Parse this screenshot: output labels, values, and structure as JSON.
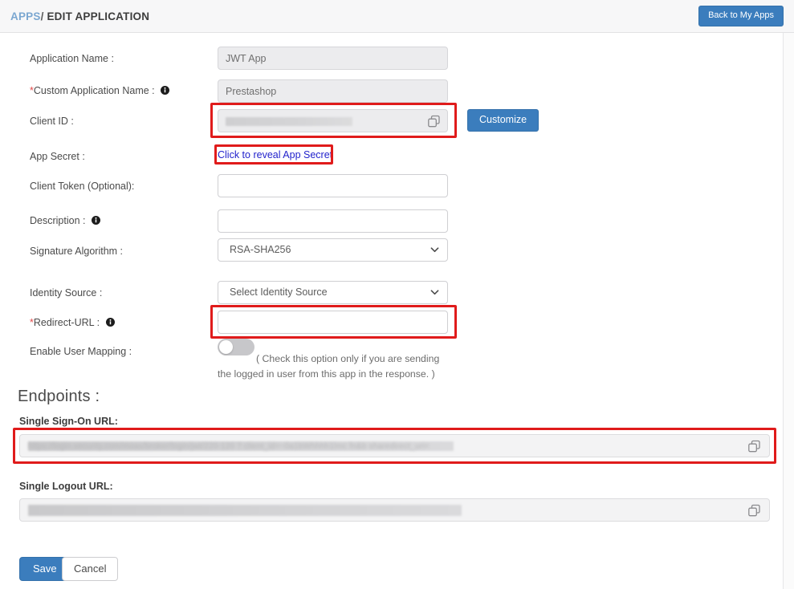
{
  "header": {
    "breadcrumb_root": "APPS",
    "breadcrumb_separator": "/",
    "breadcrumb_current": "EDIT APPLICATION",
    "back_button": "Back to My Apps",
    "accent_color": "#3b7dbd",
    "breadcrumb_link_color": "#7ba7d1"
  },
  "form": {
    "application_name": {
      "label": "Application Name :",
      "value": "JWT App",
      "readonly": true
    },
    "custom_application_name": {
      "label": "Custom Application Name :",
      "required_marker": "*",
      "value": "Prestashop",
      "readonly": true,
      "info_icon": "info-icon"
    },
    "client_id": {
      "label": "Client ID :",
      "value": "",
      "masked": true,
      "copy_icon": "copy-icon",
      "highlighted": true
    },
    "customize_button": "Customize",
    "app_secret": {
      "label": "App Secret :",
      "reveal_link": "Click to reveal App Secret",
      "link_color": "#2222cc",
      "highlighted": true
    },
    "client_token": {
      "label": "Client Token (Optional):",
      "value": "",
      "placeholder": ""
    },
    "description": {
      "label": "Description :",
      "value": "",
      "placeholder": "",
      "info_icon": "info-icon"
    },
    "signature_algorithm": {
      "label": "Signature Algorithm :",
      "selected": "RSA-SHA256",
      "chevron_icon": "chevron-down-icon"
    },
    "identity_source": {
      "label": "Identity Source :",
      "selected": "Select Identity Source",
      "chevron_icon": "chevron-down-icon"
    },
    "redirect_url": {
      "label": "Redirect-URL :",
      "required_marker": "*",
      "value": "",
      "placeholder": "",
      "info_icon": "info-icon",
      "highlighted": true
    },
    "enable_user_mapping": {
      "label": "Enable User Mapping :",
      "toggle_state": "off",
      "hint": "( Check this option only if you are sending the logged in user from this app in the response. )"
    }
  },
  "endpoints": {
    "title": "Endpoints :",
    "single_sign_on": {
      "label": "Single Sign-On URL:",
      "value": "",
      "masked": true,
      "copy_icon": "copy-icon",
      "highlighted": true
    },
    "single_logout": {
      "label": "Single Logout URL:",
      "value": "",
      "masked": true,
      "copy_icon": "copy-icon",
      "highlighted": false
    }
  },
  "footer": {
    "save_label": "Save",
    "cancel_label": "Cancel"
  },
  "highlight_color": "#e01b1b"
}
